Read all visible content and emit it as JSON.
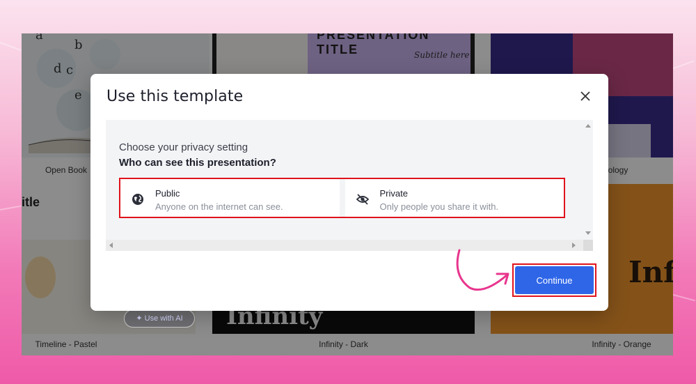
{
  "modal": {
    "title": "Use this template",
    "privacy_heading": "Choose your privacy setting",
    "privacy_question": "Who can see this presentation?",
    "options": [
      {
        "title": "Public",
        "subtitle": "Anyone on the internet can see.",
        "icon": "globe-icon"
      },
      {
        "title": "Private",
        "subtitle": "Only people you share it with.",
        "icon": "eye-off-icon"
      }
    ],
    "continue_label": "Continue"
  },
  "gallery": {
    "cards": [
      {
        "label": "Open Book"
      },
      {
        "label": "Timeline - Pastel"
      },
      {
        "label": "Infinity - Dark"
      },
      {
        "label": "Infinity - Orange"
      },
      {
        "label": "iology"
      }
    ],
    "section_title_fragment": "itle",
    "preview_title_fragment": "PRESENTATION TITLE",
    "preview_subtitle": "Subtitle here",
    "infinity_dark_text": "Infinity",
    "infinity_orange_text": "Infi",
    "use_ai_label": "Use with AI"
  },
  "colors": {
    "accent": "#2f66e8",
    "highlight": "#e0121b",
    "annotation_arrow": "#e8358d",
    "background_pink": "#f27ab8"
  }
}
